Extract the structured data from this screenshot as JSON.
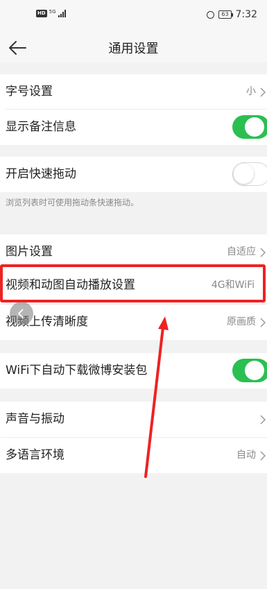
{
  "status_bar": {
    "network": "HD",
    "signal": "5G",
    "battery": "63",
    "time": "7:32"
  },
  "header": {
    "title": "通用设置"
  },
  "sections": {
    "font_size": {
      "label": "字号设置",
      "value": "小"
    },
    "show_remark": {
      "label": "显示备注信息",
      "toggle": "on"
    },
    "fast_drag": {
      "label": "开启快速拖动",
      "toggle": "off",
      "hint": "浏览列表时可使用拖动条快速拖动。"
    },
    "image_settings": {
      "label": "图片设置",
      "value": "自适应"
    },
    "autoplay": {
      "label": "视频和动图自动播放设置",
      "value": "4G和WiFi"
    },
    "upload_quality": {
      "label": "视频上传清晰度",
      "value": "原画质"
    },
    "wifi_download": {
      "label": "WiFi下自动下载微博安装包",
      "toggle": "on"
    },
    "sound_vibration": {
      "label": "声音与振动"
    },
    "language": {
      "label": "多语言环境",
      "value": "自动"
    }
  },
  "colors": {
    "toggle_on": "#2bbf52",
    "highlight": "#ee2222",
    "background": "#f2f2f2"
  },
  "icons": {
    "back": "back-arrow-icon",
    "chevron": "chevron-right-icon",
    "float": "float-collapse-icon"
  }
}
